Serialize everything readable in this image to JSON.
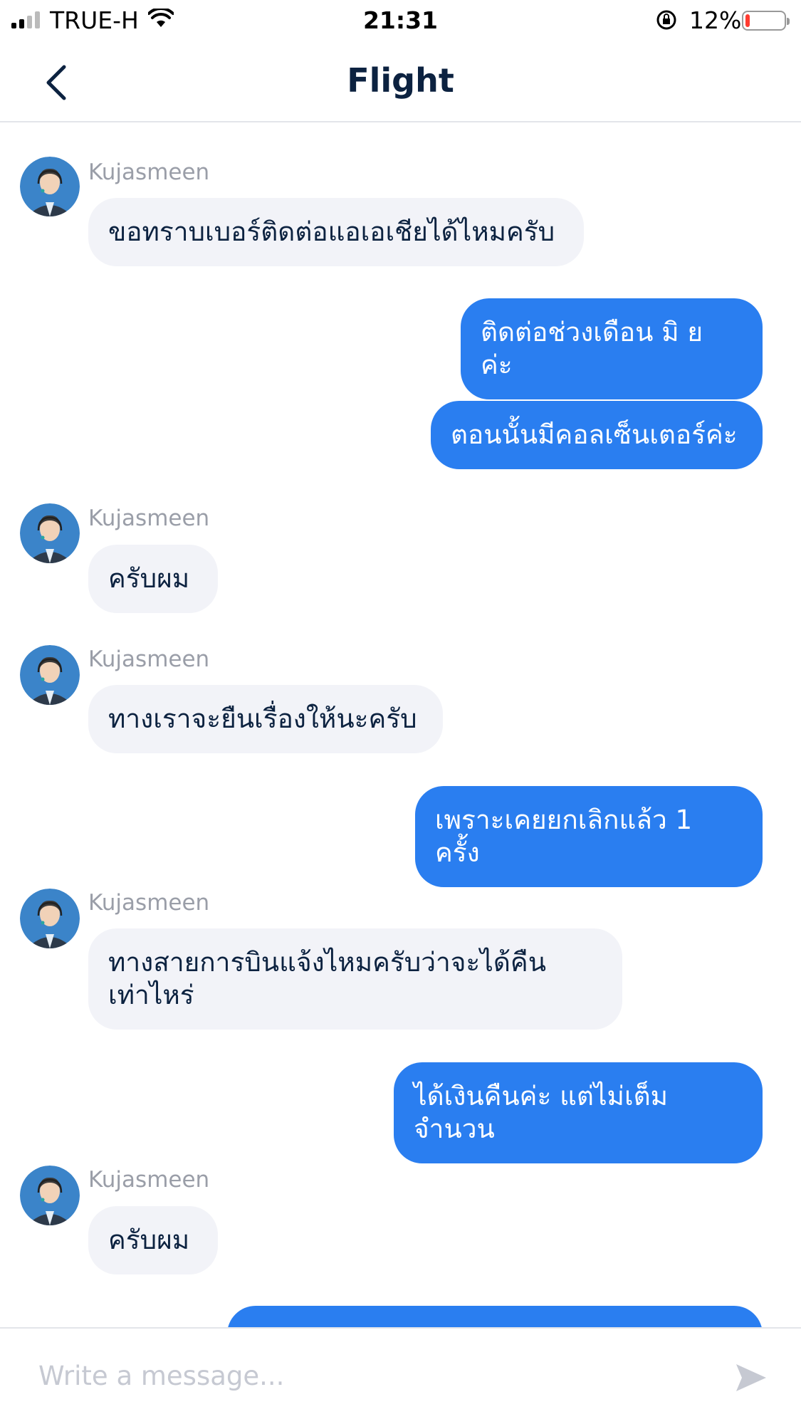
{
  "status_bar": {
    "carrier": "TRUE-H",
    "time": "21:31",
    "battery_percent": "12%",
    "battery_level": 0.12,
    "battery_color": "#ff3b30"
  },
  "nav": {
    "title": "Flight",
    "back_icon": "chevron-left-icon"
  },
  "messages": [
    {
      "side": "in",
      "sender": "Kujasmeen",
      "text": "ขอทราบเบอร์ติดต่อแอเอเชียได้ไหมครับ"
    },
    {
      "side": "out",
      "text": "ติดต่อช่วงเดือน มิ ย ค่ะ"
    },
    {
      "side": "out",
      "text": "ตอนนั้นมีคอลเซ็นเตอร์ค่ะ"
    },
    {
      "side": "in",
      "sender": "Kujasmeen",
      "text": "ครับผม"
    },
    {
      "side": "in",
      "sender": "Kujasmeen",
      "text": "ทางเราจะยืนเรื่องให้นะครับ"
    },
    {
      "side": "out",
      "text": "เพราะเคยยกเลิกแล้ว 1 ครั้ง"
    },
    {
      "side": "in",
      "sender": "Kujasmeen",
      "text": "ทางสายการบินแจ้งไหมครับว่าจะได้คืน\nเท่าไหร่"
    },
    {
      "side": "out",
      "text": "ได้เงินคืนค่ะ แต่ไม่เต็มจำนวน"
    },
    {
      "side": "in",
      "sender": "Kujasmeen",
      "text": "ครับผม"
    }
  ],
  "composer": {
    "placeholder": "Write a message...",
    "send_icon": "send-icon"
  },
  "colors": {
    "accent": "#2a7ef0",
    "incoming_bubble": "#f2f3f8",
    "title_text": "#0c2240"
  }
}
